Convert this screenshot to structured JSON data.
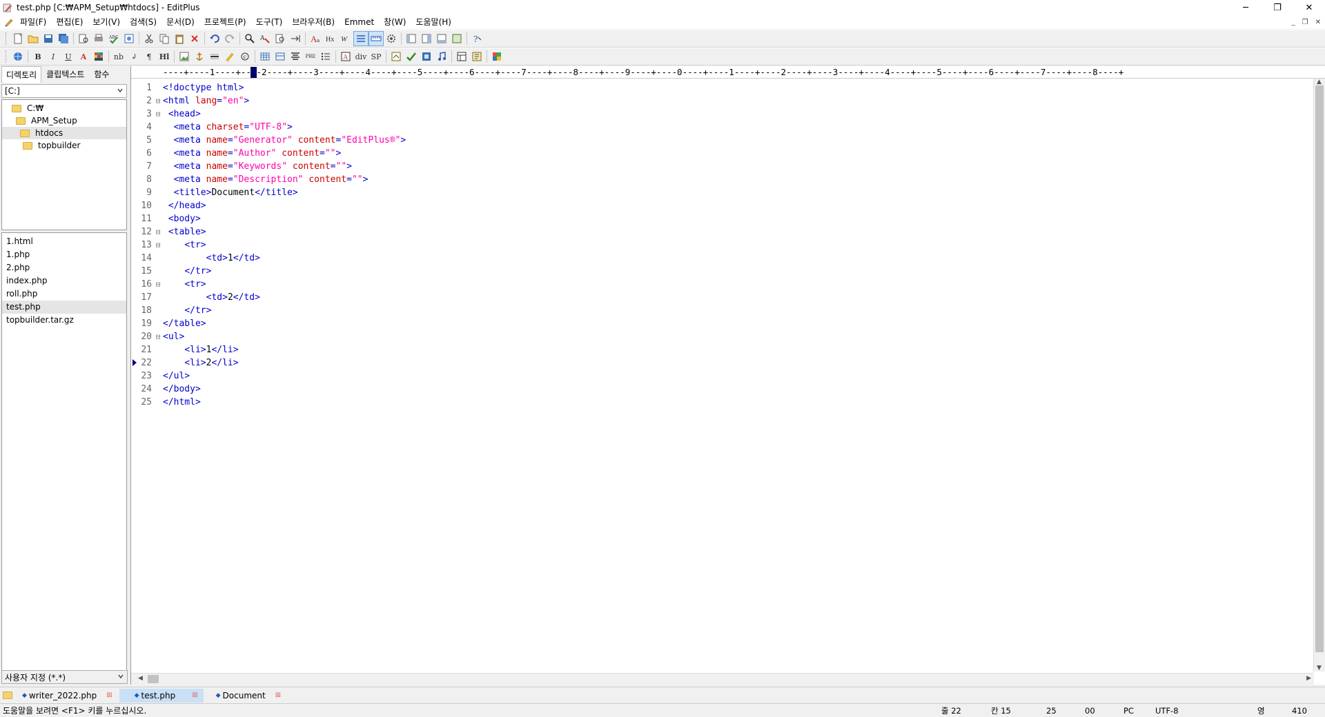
{
  "window": {
    "title": "test.php [C:₩APM_Setup₩htdocs] - EditPlus",
    "minimize": "─",
    "restore": "❐",
    "close": "✕"
  },
  "menu": {
    "items": [
      "파일(F)",
      "편집(E)",
      "보기(V)",
      "검색(S)",
      "문서(D)",
      "프로젝트(P)",
      "도구(T)",
      "브라우저(B)",
      "Emmet",
      "창(W)",
      "도움말(H)"
    ],
    "mdi_minimize": "_",
    "mdi_restore": "❐",
    "mdi_close": "✕"
  },
  "toolbar2_labels": {
    "bold": "B",
    "italic": "I",
    "underline": "U",
    "font_color": "A",
    "nbsp": "nb",
    "br": "↲",
    "para": "¶",
    "heading": "Hl",
    "pre": "PRE",
    "div": "div",
    "span": "SP"
  },
  "sidebar": {
    "tabs": [
      "디렉토리",
      "클립텍스트",
      "함수"
    ],
    "drive": "[C:]",
    "tree": [
      {
        "label": "C:₩",
        "indent": 0
      },
      {
        "label": "APM_Setup",
        "indent": 1
      },
      {
        "label": "htdocs",
        "indent": 2
      },
      {
        "label": "topbuilder",
        "indent": 3
      }
    ],
    "files": [
      "1.html",
      "1.php",
      "2.php",
      "index.php",
      "roll.php",
      "test.php",
      "topbuilder.tar.gz"
    ],
    "filter": "사용자 지정 (*.*)"
  },
  "ruler": "----+----1----+----2----+----3----+----4----+----5----+----6----+----7----+----8----+----9----+----0----+----1----+----2----+----3----+----4----+----5----+----6----+----7----+----8----+",
  "editor": {
    "current_line": 22
  },
  "code_lines": [
    {
      "n": "1",
      "fold": "",
      "parts": [
        {
          "c": "tag",
          "t": "<!doctype html>"
        }
      ]
    },
    {
      "n": "2",
      "fold": "⊟",
      "parts": [
        {
          "c": "tag",
          "t": "<html "
        },
        {
          "c": "attr",
          "t": "lang"
        },
        {
          "c": "tag",
          "t": "="
        },
        {
          "c": "val",
          "t": "\"en\""
        },
        {
          "c": "tag",
          "t": ">"
        }
      ]
    },
    {
      "n": "3",
      "fold": "⊟",
      "parts": [
        {
          "c": "code",
          "t": " "
        },
        {
          "c": "tag",
          "t": "<head>"
        }
      ]
    },
    {
      "n": "4",
      "fold": "",
      "parts": [
        {
          "c": "code",
          "t": "  "
        },
        {
          "c": "tag",
          "t": "<meta "
        },
        {
          "c": "attr",
          "t": "charset"
        },
        {
          "c": "tag",
          "t": "="
        },
        {
          "c": "val",
          "t": "\"UTF-8\""
        },
        {
          "c": "tag",
          "t": ">"
        }
      ]
    },
    {
      "n": "5",
      "fold": "",
      "parts": [
        {
          "c": "code",
          "t": "  "
        },
        {
          "c": "tag",
          "t": "<meta "
        },
        {
          "c": "attr",
          "t": "name"
        },
        {
          "c": "tag",
          "t": "="
        },
        {
          "c": "val",
          "t": "\"Generator\""
        },
        {
          "c": "tag",
          "t": " "
        },
        {
          "c": "attr",
          "t": "content"
        },
        {
          "c": "tag",
          "t": "="
        },
        {
          "c": "val",
          "t": "\"EditPlus®\""
        },
        {
          "c": "tag",
          "t": ">"
        }
      ]
    },
    {
      "n": "6",
      "fold": "",
      "parts": [
        {
          "c": "code",
          "t": "  "
        },
        {
          "c": "tag",
          "t": "<meta "
        },
        {
          "c": "attr",
          "t": "name"
        },
        {
          "c": "tag",
          "t": "="
        },
        {
          "c": "val",
          "t": "\"Author\""
        },
        {
          "c": "tag",
          "t": " "
        },
        {
          "c": "attr",
          "t": "content"
        },
        {
          "c": "tag",
          "t": "="
        },
        {
          "c": "val",
          "t": "\"\""
        },
        {
          "c": "tag",
          "t": ">"
        }
      ]
    },
    {
      "n": "7",
      "fold": "",
      "parts": [
        {
          "c": "code",
          "t": "  "
        },
        {
          "c": "tag",
          "t": "<meta "
        },
        {
          "c": "attr",
          "t": "name"
        },
        {
          "c": "tag",
          "t": "="
        },
        {
          "c": "val",
          "t": "\"Keywords\""
        },
        {
          "c": "tag",
          "t": " "
        },
        {
          "c": "attr",
          "t": "content"
        },
        {
          "c": "tag",
          "t": "="
        },
        {
          "c": "val",
          "t": "\"\""
        },
        {
          "c": "tag",
          "t": ">"
        }
      ]
    },
    {
      "n": "8",
      "fold": "",
      "parts": [
        {
          "c": "code",
          "t": "  "
        },
        {
          "c": "tag",
          "t": "<meta "
        },
        {
          "c": "attr",
          "t": "name"
        },
        {
          "c": "tag",
          "t": "="
        },
        {
          "c": "val",
          "t": "\"Description\""
        },
        {
          "c": "tag",
          "t": " "
        },
        {
          "c": "attr",
          "t": "content"
        },
        {
          "c": "tag",
          "t": "="
        },
        {
          "c": "val",
          "t": "\"\""
        },
        {
          "c": "tag",
          "t": ">"
        }
      ]
    },
    {
      "n": "9",
      "fold": "",
      "parts": [
        {
          "c": "code",
          "t": "  "
        },
        {
          "c": "tag",
          "t": "<title>"
        },
        {
          "c": "code",
          "t": "Document"
        },
        {
          "c": "tag",
          "t": "</title>"
        }
      ]
    },
    {
      "n": "10",
      "fold": "",
      "parts": [
        {
          "c": "code",
          "t": " "
        },
        {
          "c": "tag",
          "t": "</head>"
        }
      ]
    },
    {
      "n": "11",
      "fold": "",
      "parts": [
        {
          "c": "code",
          "t": " "
        },
        {
          "c": "tag",
          "t": "<body>"
        }
      ]
    },
    {
      "n": "12",
      "fold": "⊟",
      "parts": [
        {
          "c": "code",
          "t": " "
        },
        {
          "c": "tag",
          "t": "<table>"
        }
      ]
    },
    {
      "n": "13",
      "fold": "⊟",
      "parts": [
        {
          "c": "code",
          "t": "    "
        },
        {
          "c": "tag",
          "t": "<tr>"
        }
      ]
    },
    {
      "n": "14",
      "fold": "",
      "parts": [
        {
          "c": "code",
          "t": "        "
        },
        {
          "c": "tag",
          "t": "<td>"
        },
        {
          "c": "code",
          "t": "1"
        },
        {
          "c": "tag",
          "t": "</td>"
        }
      ]
    },
    {
      "n": "15",
      "fold": "",
      "parts": [
        {
          "c": "code",
          "t": "    "
        },
        {
          "c": "tag",
          "t": "</tr>"
        }
      ]
    },
    {
      "n": "16",
      "fold": "⊟",
      "parts": [
        {
          "c": "code",
          "t": "    "
        },
        {
          "c": "tag",
          "t": "<tr>"
        }
      ]
    },
    {
      "n": "17",
      "fold": "",
      "parts": [
        {
          "c": "code",
          "t": "        "
        },
        {
          "c": "tag",
          "t": "<td>"
        },
        {
          "c": "code",
          "t": "2"
        },
        {
          "c": "tag",
          "t": "</td>"
        }
      ]
    },
    {
      "n": "18",
      "fold": "",
      "parts": [
        {
          "c": "code",
          "t": "    "
        },
        {
          "c": "tag",
          "t": "</tr>"
        }
      ]
    },
    {
      "n": "19",
      "fold": "",
      "parts": [
        {
          "c": "tag",
          "t": "</table>"
        }
      ]
    },
    {
      "n": "20",
      "fold": "⊟",
      "parts": [
        {
          "c": "tag",
          "t": "<ul>"
        }
      ]
    },
    {
      "n": "21",
      "fold": "",
      "parts": [
        {
          "c": "code",
          "t": "    "
        },
        {
          "c": "tag",
          "t": "<li>"
        },
        {
          "c": "code",
          "t": "1"
        },
        {
          "c": "tag",
          "t": "</li>"
        }
      ]
    },
    {
      "n": "22",
      "fold": "",
      "parts": [
        {
          "c": "code",
          "t": "    "
        },
        {
          "c": "tag",
          "t": "<li>"
        },
        {
          "c": "code",
          "t": "2"
        },
        {
          "c": "tag",
          "t": "</li>"
        }
      ]
    },
    {
      "n": "23",
      "fold": "",
      "parts": [
        {
          "c": "tag",
          "t": "</ul>"
        }
      ]
    },
    {
      "n": "24",
      "fold": "",
      "parts": [
        {
          "c": "tag",
          "t": "</body>"
        }
      ]
    },
    {
      "n": "25",
      "fold": "",
      "parts": [
        {
          "c": "tag",
          "t": "</html>"
        }
      ]
    }
  ],
  "doc_tabs": [
    {
      "label": "writer_2022.php",
      "active": false,
      "close": "⊠"
    },
    {
      "label": "test.php",
      "active": true,
      "close": "⊠"
    },
    {
      "label": "Document",
      "active": false,
      "close": "⊠"
    }
  ],
  "status": {
    "help": "도움말을 보려면 <F1> 키를 누르십시오.",
    "line": "줄 22",
    "col": "칸 15",
    "total_lines": "25",
    "code": "00",
    "mode": "PC",
    "encoding": "UTF-8",
    "ime": "영",
    "size": "410"
  },
  "colors": {
    "tag": "#0000cc",
    "attr": "#cc0000",
    "value": "#ff00aa",
    "line_number": "#666666",
    "active_tab": "#c9e0f7"
  }
}
